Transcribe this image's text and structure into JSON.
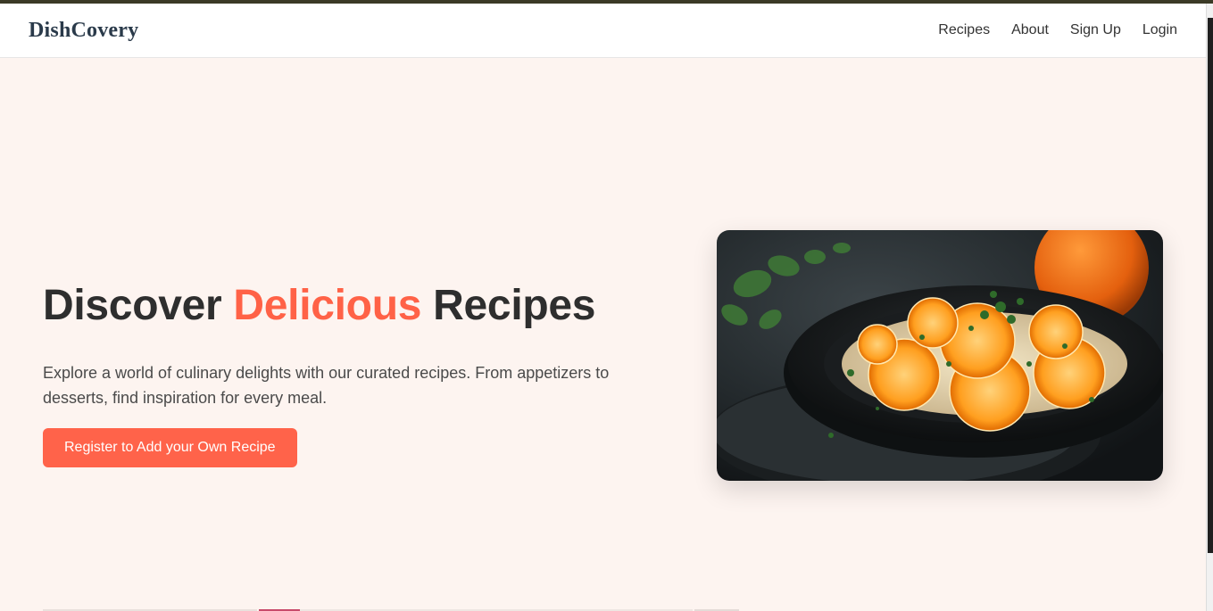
{
  "app": {
    "brand": "DishCovery"
  },
  "nav": {
    "items": [
      {
        "label": "Recipes"
      },
      {
        "label": "About"
      },
      {
        "label": "Sign Up"
      },
      {
        "label": "Login"
      }
    ]
  },
  "hero": {
    "title_part1": "Discover ",
    "title_accent": "Delicious",
    "title_part2": " Recipes",
    "description": "Explore a world of culinary delights with our curated recipes. From appetizers to desserts, find inspiration for every meal.",
    "cta_label": "Register to Add your Own Recipe",
    "image_icon": "dish-photo"
  },
  "colors": {
    "accent": "#ff6247",
    "background": "#fdf4f0",
    "text": "#2e2e2e"
  }
}
